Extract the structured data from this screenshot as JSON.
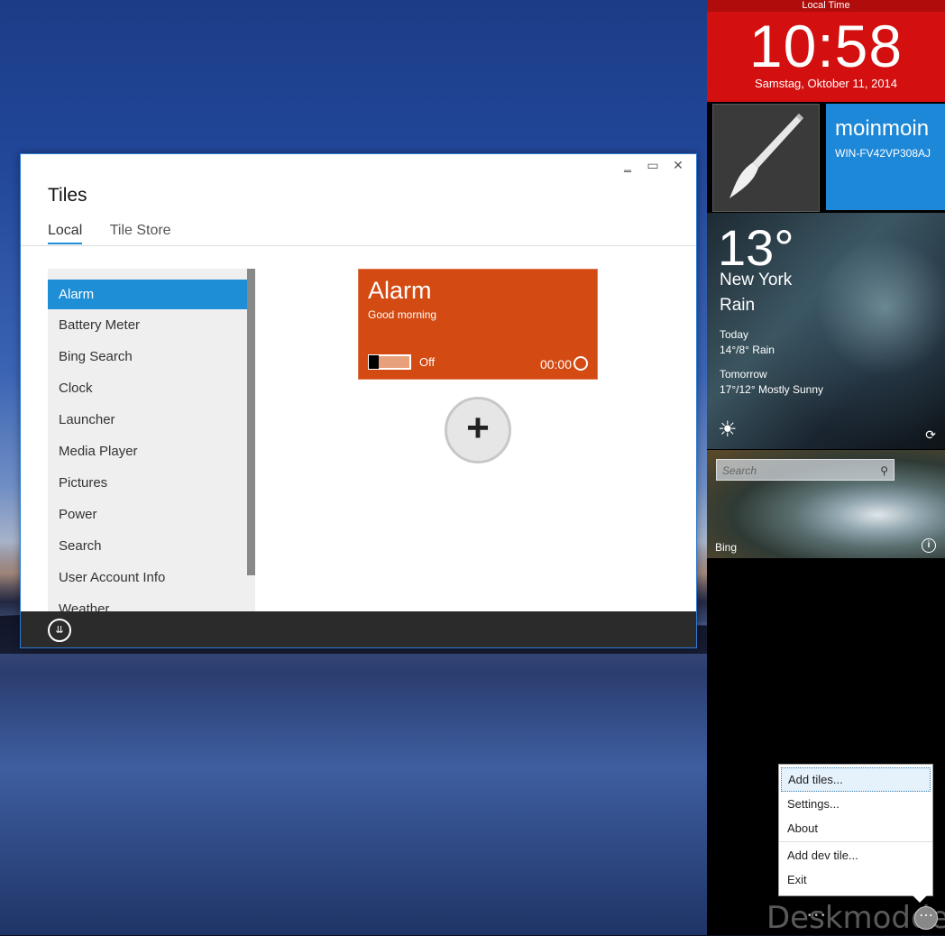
{
  "clock": {
    "label": "Local Time",
    "time": "10:58",
    "date": "Samstag, Oktober 11, 2014"
  },
  "user": {
    "name": "moinmoin",
    "host": "WIN-FV42VP308AJ"
  },
  "weather": {
    "temp": "13°",
    "city": "New York",
    "condition": "Rain",
    "today_label": "Today",
    "today": "14°/8° Rain",
    "tomorrow_label": "Tomorrow",
    "tomorrow": "17°/12° Mostly Sunny"
  },
  "bing": {
    "placeholder": "Search",
    "label": "Bing"
  },
  "context_menu": {
    "items": [
      "Add tiles...",
      "Settings...",
      "About",
      "Add dev tile...",
      "Exit"
    ]
  },
  "watermark": "Deskmodder.de",
  "window": {
    "title": "Tiles",
    "tabs": [
      "Local",
      "Tile Store"
    ],
    "list": [
      "Alarm",
      "Battery Meter",
      "Bing Search",
      "Clock",
      "Launcher",
      "Media Player",
      "Pictures",
      "Power",
      "Search",
      "User Account Info",
      "Weather"
    ],
    "alarm_tile": {
      "title": "Alarm",
      "subtitle": "Good morning",
      "state": "Off",
      "time": "00:00"
    },
    "add_symbol": "+"
  },
  "colors": {
    "clock_red": "#d30f0f",
    "user_blue": "#1e88d8",
    "alarm_orange": "#d34a12",
    "accent": "#1e8fd6"
  }
}
